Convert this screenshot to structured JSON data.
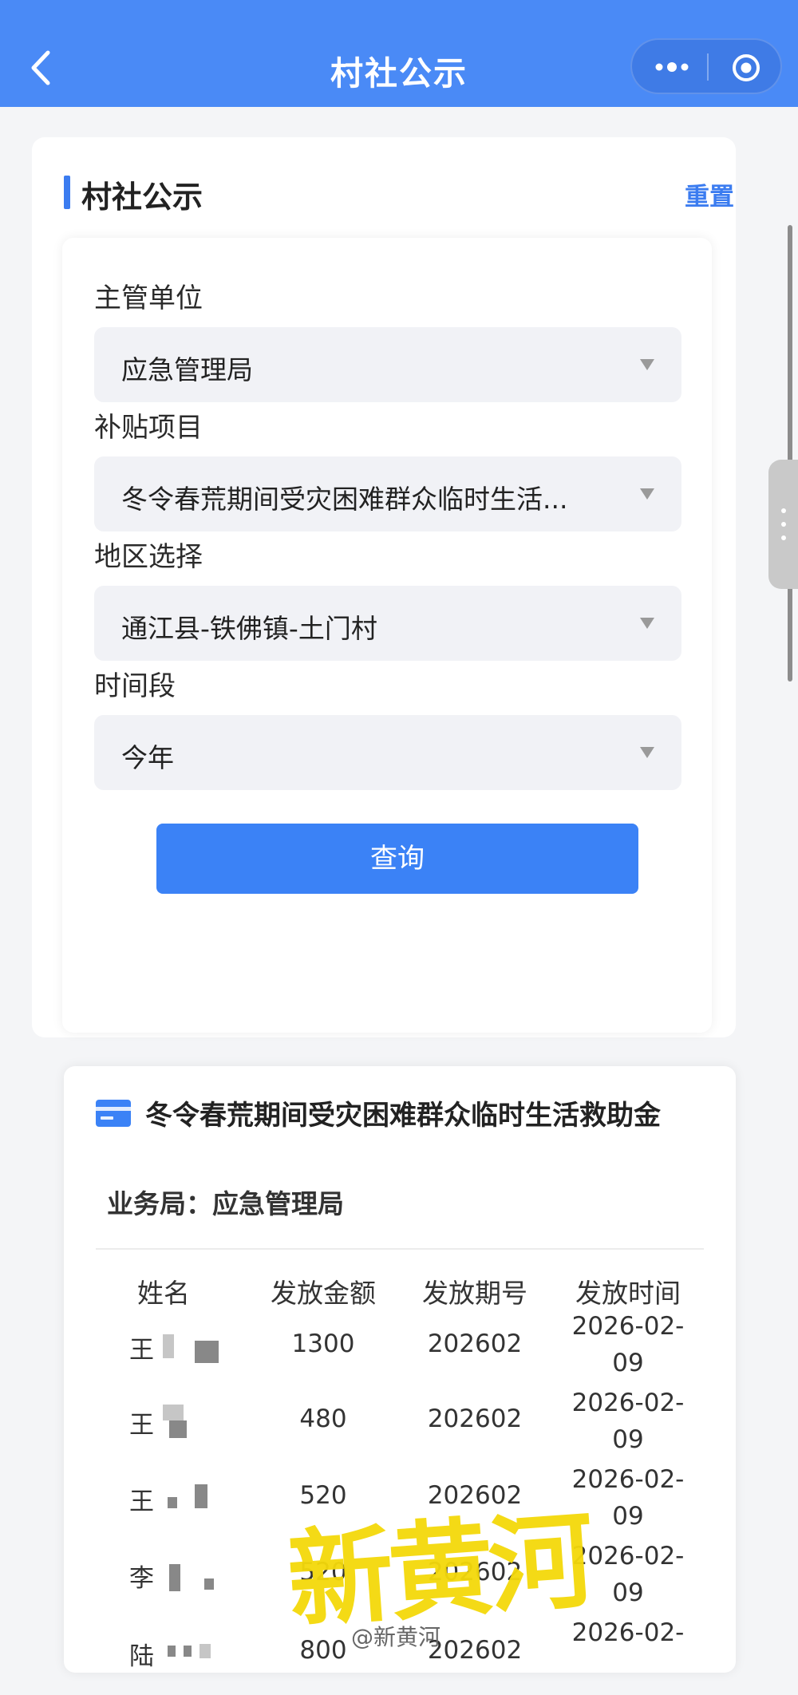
{
  "nav": {
    "title": "村社公示",
    "back_icon": "chevron-left-icon",
    "more_icon": "more-dots-icon",
    "close_icon": "target-icon"
  },
  "filter": {
    "section_title": "村社公示",
    "reset_label": "重置",
    "fields": [
      {
        "label": "主管单位",
        "value": "应急管理局"
      },
      {
        "label": "补贴项目",
        "value": "冬令春荒期间受灾困难群众临时生活..."
      },
      {
        "label": "地区选择",
        "value": "通江县-铁佛镇-土门村"
      },
      {
        "label": "时间段",
        "value": "今年"
      }
    ],
    "query_label": "查询"
  },
  "results": {
    "title": "冬令春荒期间受灾困难群众临时生活救助金",
    "bureau_label": "业务局：应急管理局",
    "columns": [
      "姓名",
      "发放金额",
      "发放期号",
      "发放时间"
    ],
    "rows": [
      {
        "name": "王",
        "amount": "1300",
        "period": "202602",
        "date_line1": "2026-02-",
        "date_line2": "09"
      },
      {
        "name": "王",
        "amount": "480",
        "period": "202602",
        "date_line1": "2026-02-",
        "date_line2": "09"
      },
      {
        "name": "王",
        "amount": "520",
        "period": "202602",
        "date_line1": "2026-02-",
        "date_line2": "09"
      },
      {
        "name": "李",
        "amount": "520",
        "period": "202602",
        "date_line1": "2026-02-",
        "date_line2": "09"
      },
      {
        "name": "陆",
        "amount": "800",
        "period": "202602",
        "date_line1": "2026-02-",
        "date_line2": ""
      }
    ]
  },
  "watermark": {
    "text": "新黄河",
    "weibo": "@新黄河"
  },
  "colors": {
    "nav_bg": "#4a8af6",
    "accent": "#3b82f6",
    "watermark": "#f4d90a"
  }
}
